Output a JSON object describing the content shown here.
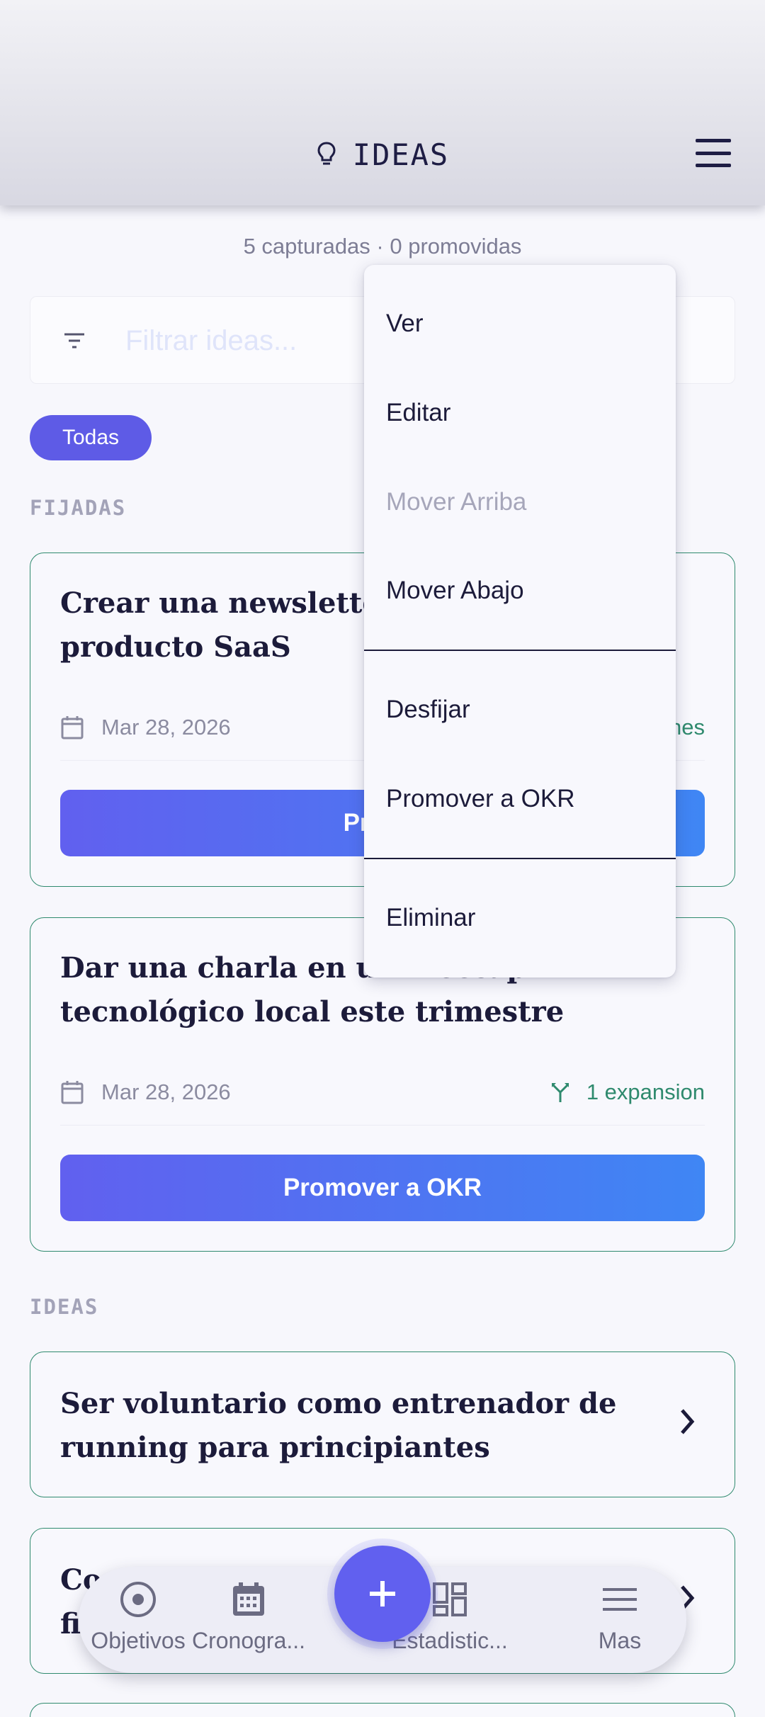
{
  "header": {
    "title": "IDEAS",
    "icon": "lightbulb-icon",
    "menu_icon": "hamburger-menu-icon"
  },
  "summary": "5 capturadas · 0 promovidas",
  "filter": {
    "placeholder": "Filtrar ideas...",
    "value": ""
  },
  "chips": [
    {
      "label": "Todas",
      "selected": true
    }
  ],
  "sections": {
    "pinned": "FIJADAS",
    "ideas": "IDEAS"
  },
  "pinned_cards": [
    {
      "title": "Crear una newsletter",
      "title_line2": "producto SaaS",
      "date": "Mar 28, 2026",
      "expansions": "nes",
      "button": "Promo"
    },
    {
      "title": "Dar una charla en un meetup tecnológico local este trimestre",
      "date": "Mar 28, 2026",
      "expansions": "1 expansion",
      "button": "Promover a OKR"
    }
  ],
  "idea_cards": [
    {
      "title": "Ser voluntario como entrenador de running para principiantes"
    },
    {
      "title": "Co",
      "title_line2": "fi"
    }
  ],
  "context_menu": {
    "items": [
      {
        "label": "Ver",
        "disabled": false
      },
      {
        "label": "Editar",
        "disabled": false
      },
      {
        "label": "Mover Arriba",
        "disabled": true
      },
      {
        "label": "Mover Abajo",
        "disabled": false
      },
      {
        "label": "Desfijar",
        "disabled": false
      },
      {
        "label": "Promover a OKR",
        "disabled": false
      },
      {
        "label": "Eliminar",
        "disabled": false
      }
    ]
  },
  "bottom_nav": {
    "items": [
      {
        "label": "Objetivos",
        "icon": "target-icon"
      },
      {
        "label": "Cronogra...",
        "icon": "calendar-icon"
      },
      {
        "label": "Estadistic...",
        "icon": "dashboard-icon"
      },
      {
        "label": "Mas",
        "icon": "menu-icon"
      }
    ],
    "fab_icon": "plus-icon"
  },
  "colors": {
    "primary": "#6160ef",
    "accent_green": "#2f8a6e",
    "text_dark": "#1c1b3a",
    "muted": "#8b8ba0"
  }
}
